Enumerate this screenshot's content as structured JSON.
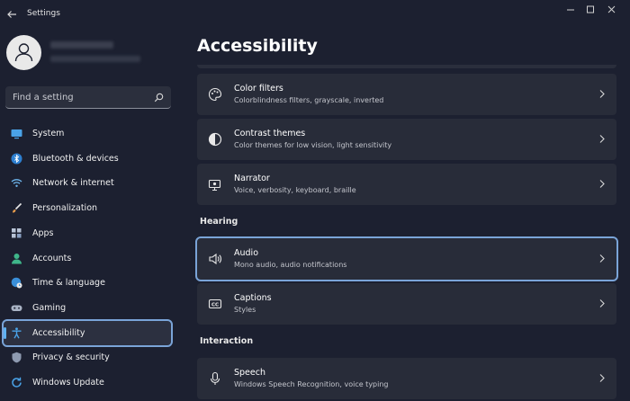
{
  "window": {
    "title": "Settings"
  },
  "sidebar": {
    "search_placeholder": "Find a setting",
    "items": [
      {
        "label": "System",
        "icon": "monitor-icon",
        "active": false
      },
      {
        "label": "Bluetooth & devices",
        "icon": "bluetooth-icon",
        "active": false
      },
      {
        "label": "Network & internet",
        "icon": "wifi-icon",
        "active": false
      },
      {
        "label": "Personalization",
        "icon": "brush-icon",
        "active": false
      },
      {
        "label": "Apps",
        "icon": "apps-icon",
        "active": false
      },
      {
        "label": "Accounts",
        "icon": "person-icon",
        "active": false
      },
      {
        "label": "Time & language",
        "icon": "globe-clock-icon",
        "active": false
      },
      {
        "label": "Gaming",
        "icon": "gamepad-icon",
        "active": false
      },
      {
        "label": "Accessibility",
        "icon": "accessibility-icon",
        "active": true
      },
      {
        "label": "Privacy & security",
        "icon": "shield-icon",
        "active": false
      },
      {
        "label": "Windows Update",
        "icon": "update-icon",
        "active": false
      }
    ]
  },
  "main": {
    "title": "Accessibility",
    "cards": [
      {
        "title": "Color filters",
        "subtitle": "Colorblindness filters, grayscale, inverted",
        "icon": "palette-icon"
      },
      {
        "title": "Contrast themes",
        "subtitle": "Color themes for low vision, light sensitivity",
        "icon": "contrast-icon"
      },
      {
        "title": "Narrator",
        "subtitle": "Voice, verbosity, keyboard, braille",
        "icon": "narrator-icon"
      }
    ],
    "sections": {
      "hearing": "Hearing",
      "interaction": "Interaction"
    },
    "hearing_cards": [
      {
        "title": "Audio",
        "subtitle": "Mono audio, audio notifications",
        "icon": "speaker-icon"
      },
      {
        "title": "Captions",
        "subtitle": "Styles",
        "icon": "captions-icon"
      }
    ],
    "interaction_cards": [
      {
        "title": "Speech",
        "subtitle": "Windows Speech Recognition, voice typing",
        "icon": "microphone-icon"
      }
    ]
  },
  "colors": {
    "background": "#1c2030",
    "card": "#282c39",
    "highlight_outline": "#7aa4d8",
    "accent": "#5fb2f2"
  }
}
